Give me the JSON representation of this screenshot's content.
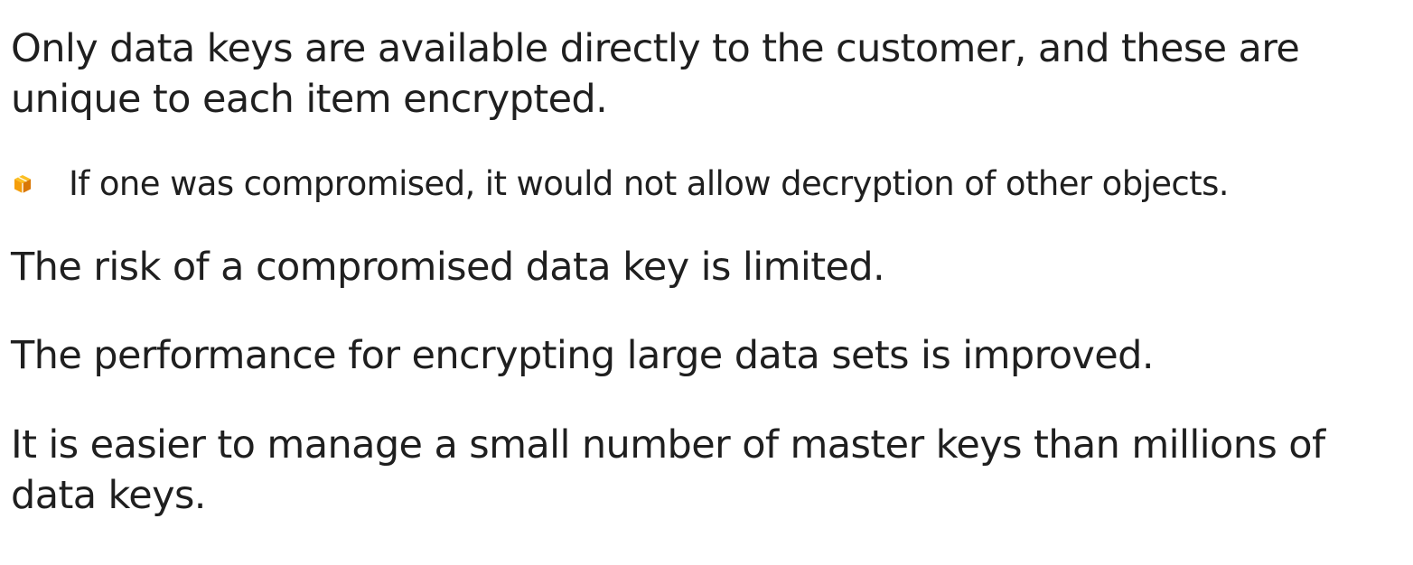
{
  "paragraphs": {
    "p1_line1": "Only data keys are available directly to the customer, and these are",
    "p1_line2": "unique to each item encrypted.",
    "bullet": {
      "icon": "amazon-box-icon",
      "text": "If one was compromised, it would not allow decryption of other objects.",
      "icon_color": "#f59e0b"
    },
    "p2": "The risk of a compromised data key is limited.",
    "p3": "The performance for encrypting large data sets is improved.",
    "p4_line1": "It is easier to manage a small number of master keys than millions of",
    "p4_line2": "data keys."
  }
}
